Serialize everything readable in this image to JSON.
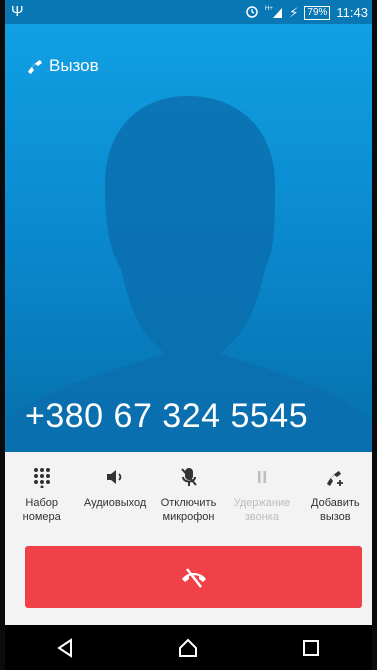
{
  "status_bar": {
    "battery_percent": "79%",
    "time": "11:43",
    "icons": [
      "usb-icon",
      "alarm-icon",
      "signal-icon",
      "charging-icon",
      "battery-icon"
    ]
  },
  "call": {
    "label": "Вызов",
    "number": "+380 67 324 5545"
  },
  "actions": [
    {
      "label": "Набор\nномера",
      "icon": "dialpad-icon",
      "enabled": true
    },
    {
      "label": "Аудиовыход",
      "icon": "speaker-icon",
      "enabled": true
    },
    {
      "label": "Отключить\nмикрофон",
      "icon": "mute-mic-icon",
      "enabled": true
    },
    {
      "label": "Удержание\nзвонка",
      "icon": "pause-icon",
      "enabled": false
    },
    {
      "label": "Добавить\nвызов",
      "icon": "add-call-icon",
      "enabled": true
    }
  ],
  "end_call": {
    "icon": "end-call-icon",
    "color": "#f04149"
  },
  "nav": [
    "back-icon",
    "home-icon",
    "recents-icon"
  ],
  "colors": {
    "accent": "#0a86cc",
    "end_call": "#f04149",
    "status_bar": "#0877b4"
  }
}
